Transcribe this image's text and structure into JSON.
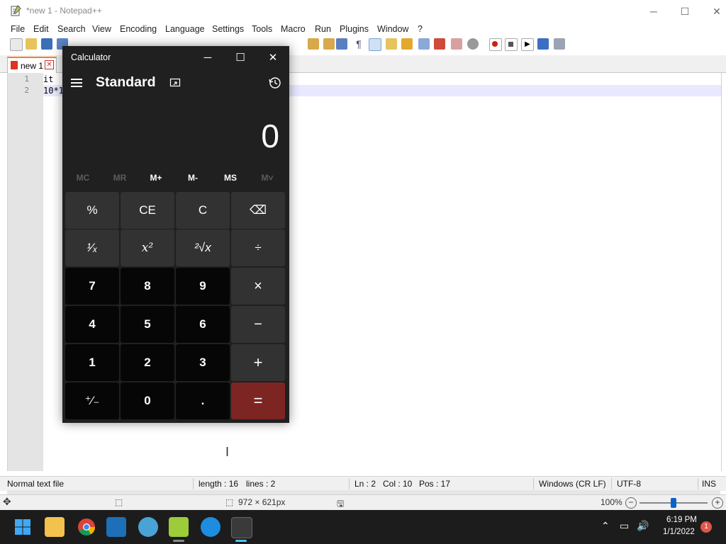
{
  "notepad": {
    "title": "*new 1 - Notepad++",
    "menu": [
      "File",
      "Edit",
      "Search",
      "View",
      "Encoding",
      "Language",
      "Settings",
      "Tools",
      "Macro",
      "Run",
      "Plugins",
      "Window",
      "?"
    ],
    "tab": {
      "label": "new 1"
    },
    "lines": [
      {
        "number": "1",
        "text": "it "
      },
      {
        "number": "2",
        "text": "10*1"
      }
    ],
    "status": {
      "type": "Normal text file",
      "length": "length : 16",
      "lines": "lines : 2",
      "ln": "Ln : 2",
      "col": "Col : 10",
      "pos": "Pos : 17",
      "eol": "Windows (CR LF)",
      "encoding": "UTF-8",
      "mode": "INS"
    },
    "viewer": {
      "dimensions": "972 × 621px",
      "zoom": "100%"
    }
  },
  "calculator": {
    "title": "Calculator",
    "mode": "Standard",
    "display": "0",
    "memory": [
      {
        "label": "MC",
        "enabled": false
      },
      {
        "label": "MR",
        "enabled": false
      },
      {
        "label": "M+",
        "enabled": true
      },
      {
        "label": "M-",
        "enabled": true
      },
      {
        "label": "MS",
        "enabled": true
      },
      {
        "label": "M˅",
        "enabled": false
      }
    ],
    "keys": [
      [
        "%",
        "CE",
        "C",
        "⌫"
      ],
      [
        "¹⁄ₓ",
        "x²",
        "²√x",
        "÷"
      ],
      [
        "7",
        "8",
        "9",
        "×"
      ],
      [
        "4",
        "5",
        "6",
        "−"
      ],
      [
        "1",
        "2",
        "3",
        "+"
      ],
      [
        "⁺⁄₋",
        "0",
        ".",
        "="
      ]
    ]
  },
  "taskbar": {
    "time": "6:19 PM",
    "date": "1/1/2022",
    "notification_count": "1"
  },
  "colors": {
    "equals": "#7d2523",
    "calc_bg": "#202020",
    "accent": "#0078d4"
  }
}
